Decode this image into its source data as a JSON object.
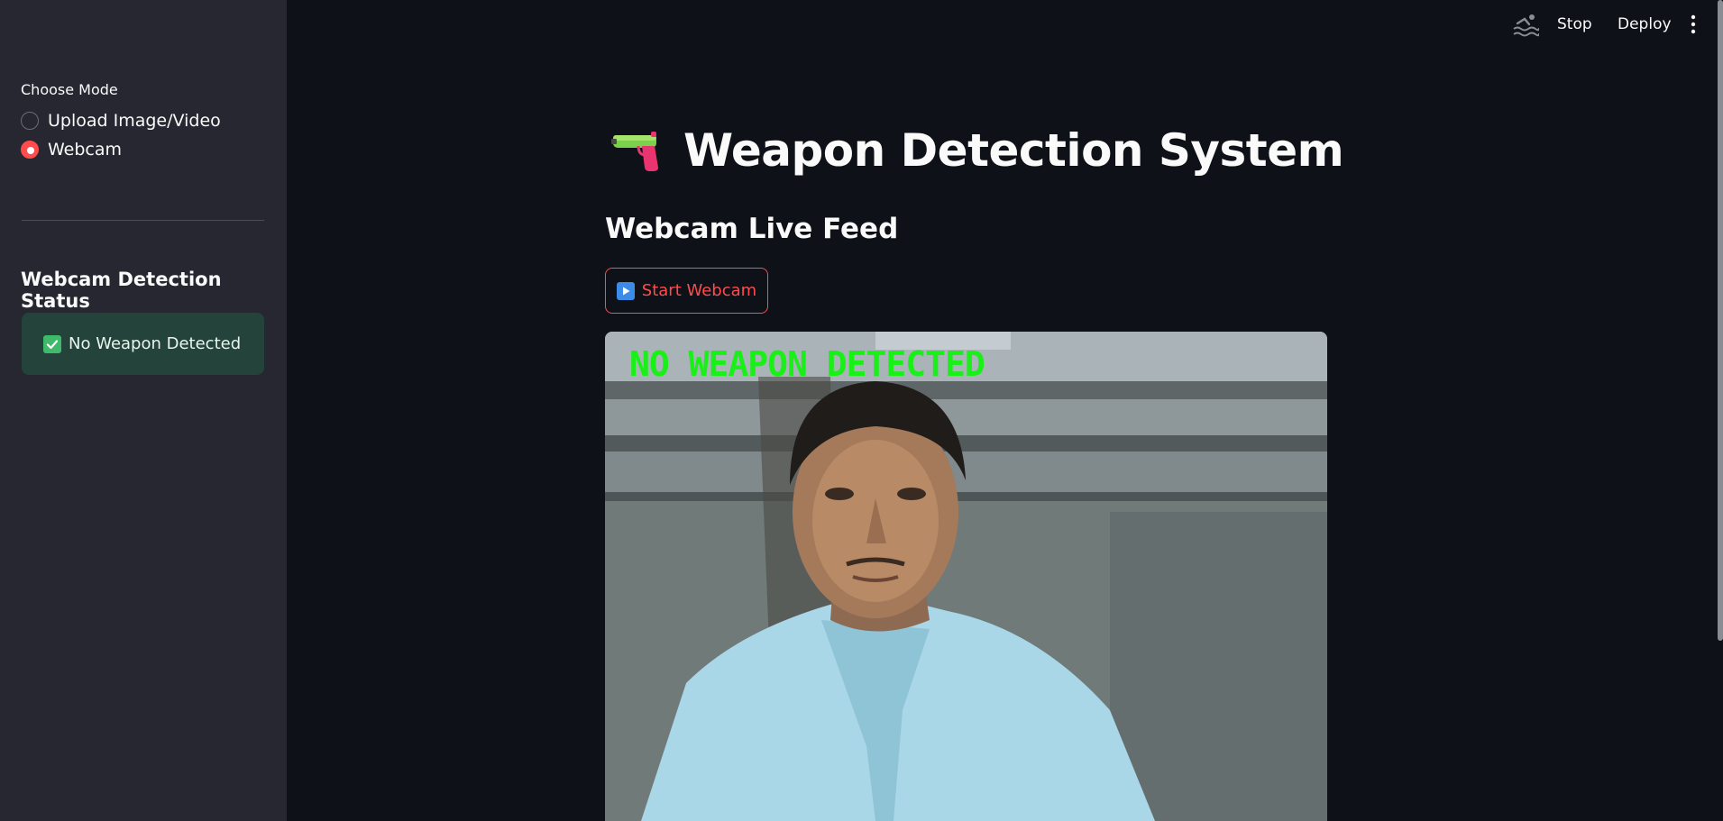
{
  "sidebar": {
    "mode_label": "Choose Mode",
    "modes": [
      {
        "label": "Upload Image/Video",
        "selected": false
      },
      {
        "label": "Webcam",
        "selected": true
      }
    ],
    "status_heading": "Webcam Detection Status",
    "status_message": "No Weapon Detected",
    "status_icon": "check-box-icon"
  },
  "topbar": {
    "running_icon": "swimmer-icon",
    "stop_label": "Stop",
    "deploy_label": "Deploy",
    "menu_icon": "kebab-menu-icon"
  },
  "main": {
    "title_icon": "water-pistol-icon",
    "title": "Weapon Detection System",
    "subheading": "Webcam Live Feed",
    "start_button_label": "Start Webcam",
    "start_button_icon": "play-icon",
    "video_overlay_text": "NO WEAPON DETECTED"
  },
  "colors": {
    "accent": "#ff4b4b",
    "background": "#0e1117",
    "sidebar": "#262730",
    "success_bg": "#24433a",
    "overlay_text": "#18f018"
  }
}
